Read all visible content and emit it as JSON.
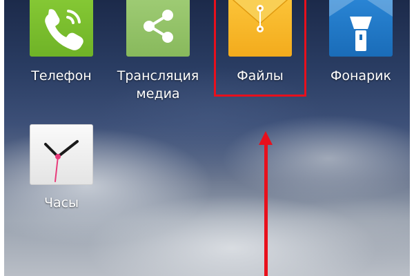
{
  "apps": [
    {
      "label": "Телефон",
      "icon": "phone-icon",
      "color": "#7cbf2d"
    },
    {
      "label": "Трансляция медиа",
      "line1": "Трансляция",
      "line2": "медиа",
      "icon": "share-icon",
      "color": "#94c46a"
    },
    {
      "label": "Файлы",
      "icon": "files-envelope-icon",
      "color": "#f7b82a"
    },
    {
      "label": "Фонарик",
      "icon": "flashlight-icon",
      "color": "#1e78c8"
    },
    {
      "label": "Часы",
      "icon": "clock-icon",
      "color": "#f2f2f2"
    }
  ],
  "annotation": {
    "color": "#e8101c",
    "target": "Файлы"
  }
}
